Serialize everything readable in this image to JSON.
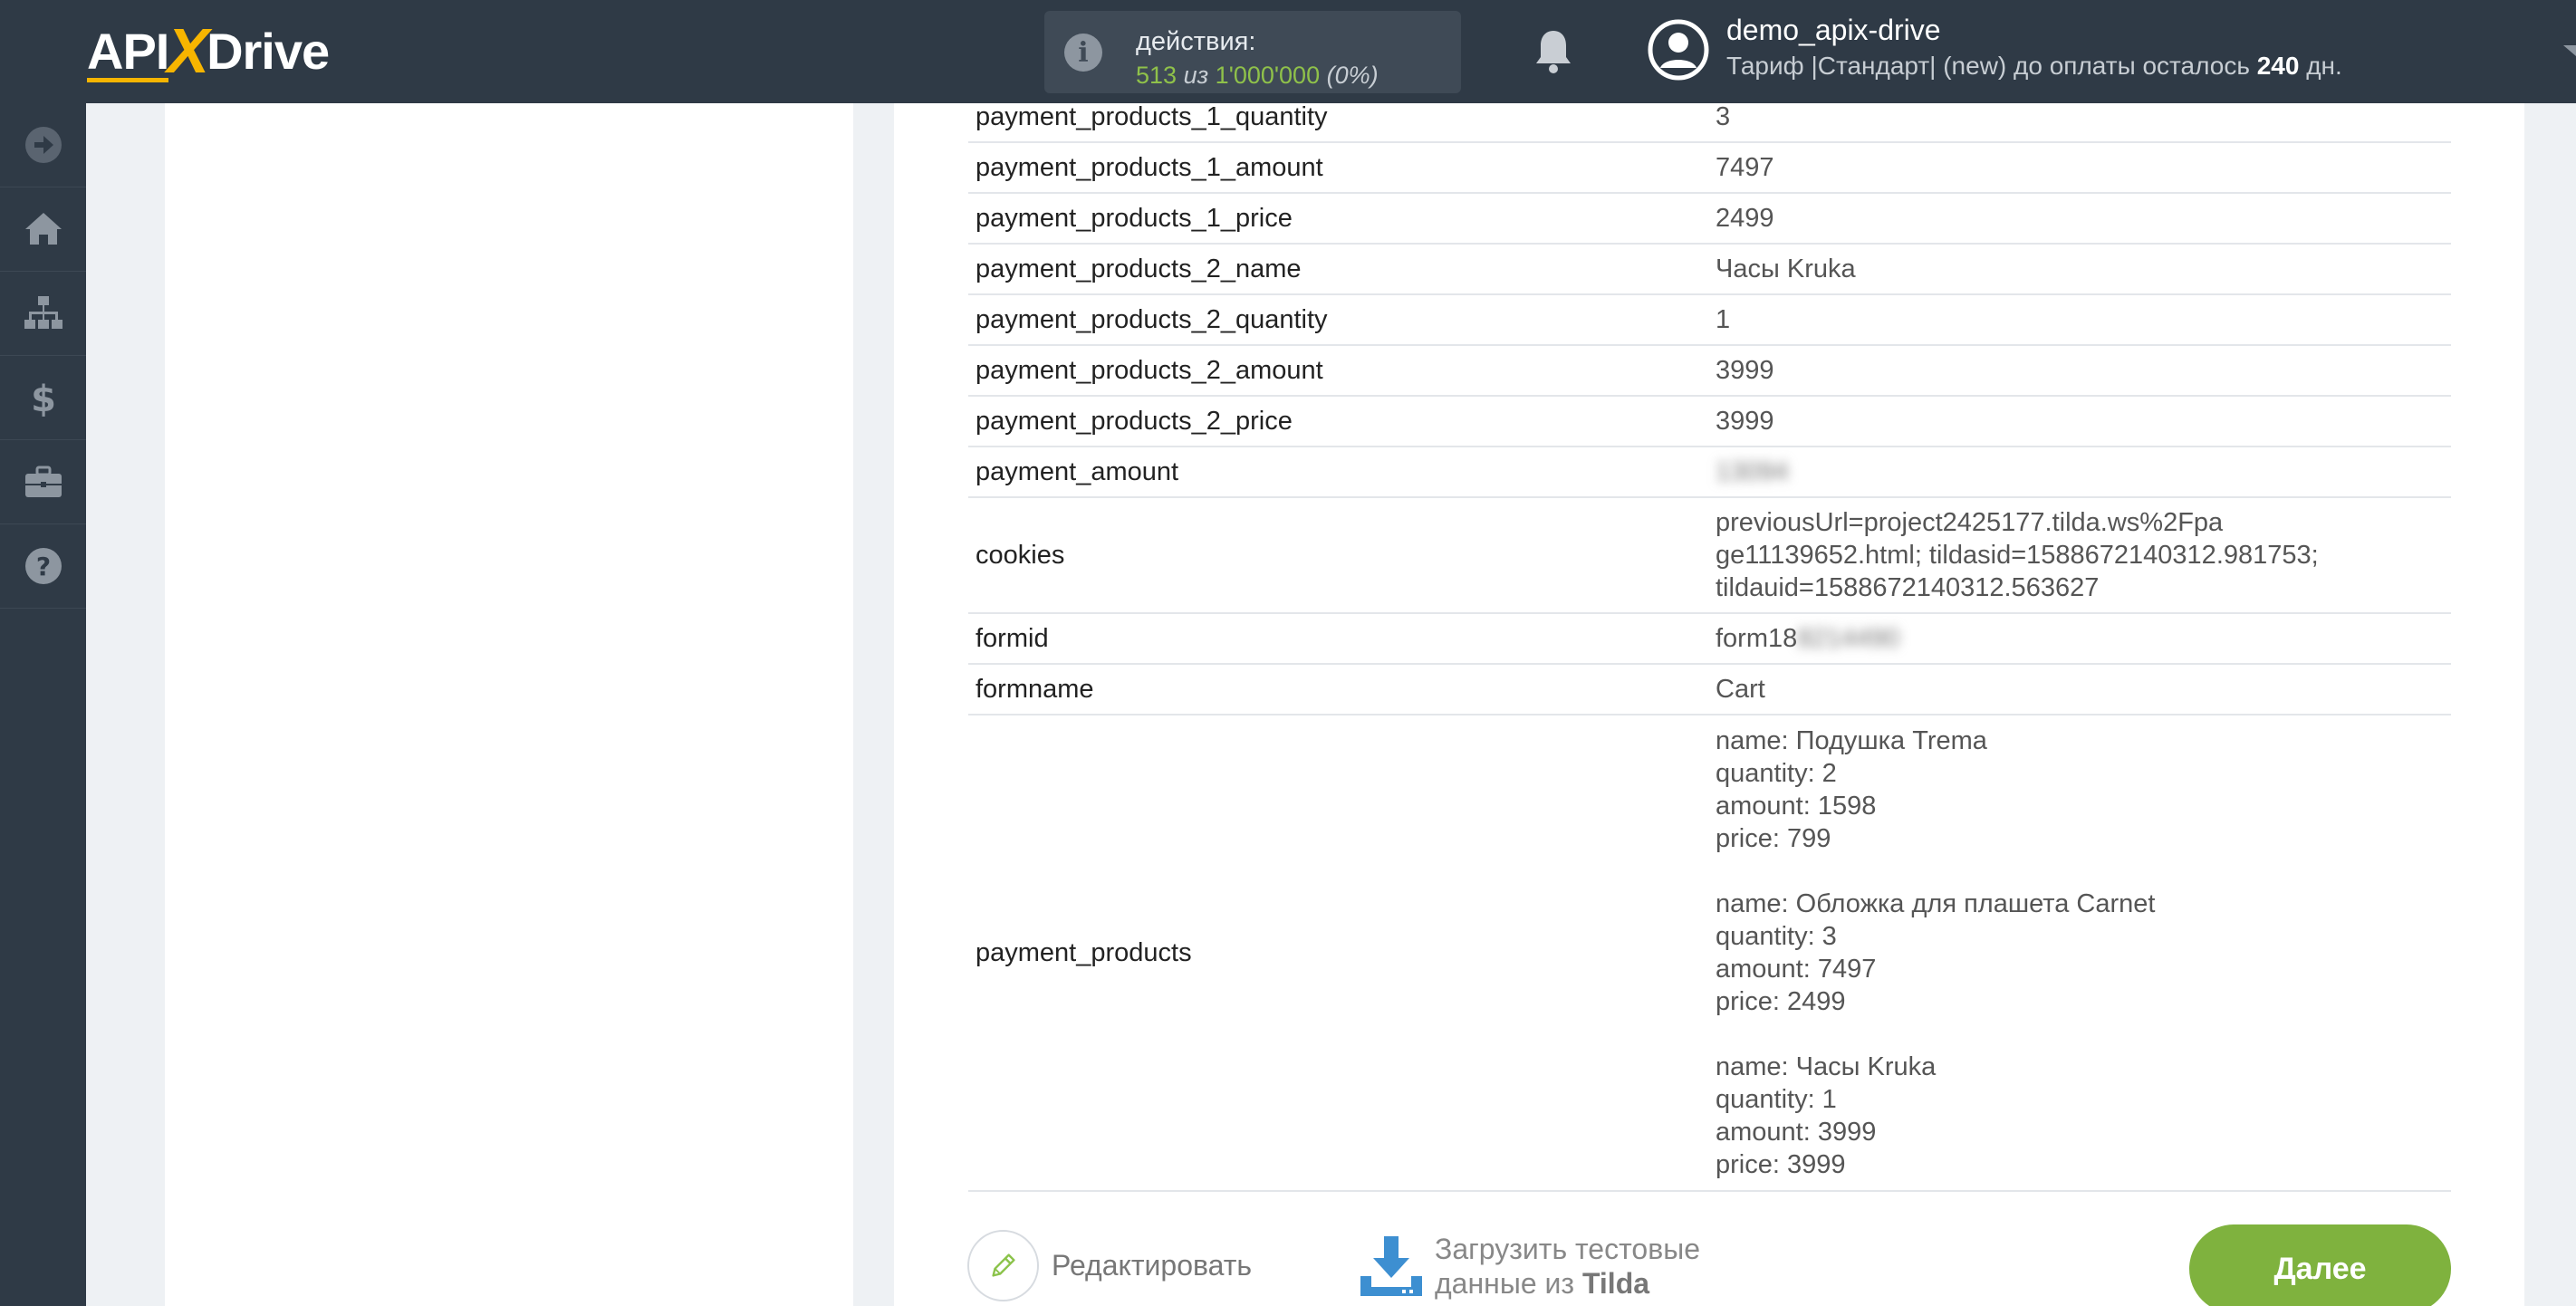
{
  "header": {
    "logo_part1": "API",
    "logo_x": "X",
    "logo_part2": "Drive",
    "actions_label": "действия:",
    "actions_used": "513",
    "actions_of": "из",
    "actions_limit": "1'000'000",
    "actions_percent": "(0%)",
    "username": "demo_apix-drive",
    "tariff_prefix": "Тариф |Стандарт| (new) до оплаты осталось",
    "tariff_days": "240",
    "tariff_suffix": "дн."
  },
  "sidebar": {
    "items": [
      {
        "icon": "arrow-right-circle-icon"
      },
      {
        "icon": "home-icon"
      },
      {
        "icon": "sitemap-icon"
      },
      {
        "icon": "dollar-icon"
      },
      {
        "icon": "briefcase-icon"
      },
      {
        "icon": "help-icon"
      }
    ]
  },
  "table": {
    "rows": [
      {
        "key": "payment_products_1_quantity",
        "value": "3"
      },
      {
        "key": "payment_products_1_amount",
        "value": "7497"
      },
      {
        "key": "payment_products_1_price",
        "value": "2499"
      },
      {
        "key": "payment_products_2_name",
        "value": "Часы Kruka"
      },
      {
        "key": "payment_products_2_quantity",
        "value": "1"
      },
      {
        "key": "payment_products_2_amount",
        "value": "3999"
      },
      {
        "key": "payment_products_2_price",
        "value": "3999"
      },
      {
        "key": "payment_amount",
        "value": "13094"
      },
      {
        "key": "cookies",
        "value_lines": [
          "previousUrl=project2425177.tilda.ws%2Fpa",
          "ge11139652.html; tildasid=1588672140312.981753;",
          "tildauid=1588672140312.563627"
        ]
      },
      {
        "key": "formid",
        "value": "form18",
        "value_hidden": "8214490"
      },
      {
        "key": "formname",
        "value": "Cart"
      },
      {
        "key": "payment_products",
        "value_lines": [
          "name: Подушка Trema",
          "quantity: 2",
          "amount: 1598",
          "price: 799",
          "",
          "name: Обложка для плашета Carnet",
          "quantity: 3",
          "amount: 7497",
          "price: 2499",
          "",
          "name: Часы Kruka",
          "quantity: 1",
          "amount: 3999",
          "price: 3999"
        ]
      }
    ]
  },
  "footer": {
    "edit_label": "Редактировать",
    "load_line1": "Загрузить тестовые",
    "load_line2_prefix": "данные из",
    "load_line2_bold": "Tilda",
    "next_label": "Далее"
  },
  "colors": {
    "topbar": "#2f3a46",
    "accent_green": "#7fb23e",
    "logo_accent": "#f7b500"
  }
}
